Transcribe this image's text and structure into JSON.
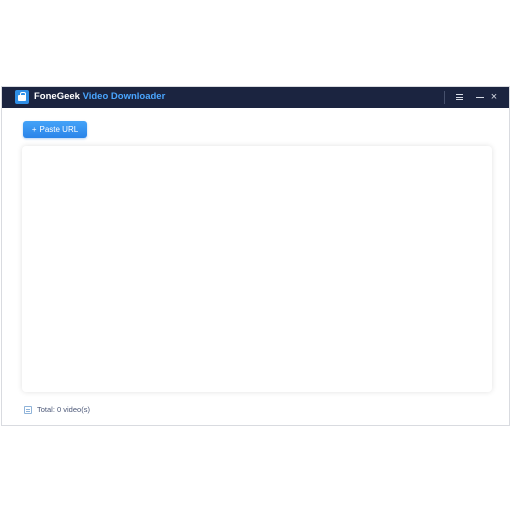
{
  "app": {
    "brand": "FoneGeek",
    "product": "Video Downloader"
  },
  "toolbar": {
    "paste_url_label": "Paste URL",
    "paste_url_prefix": "+"
  },
  "window_controls": {
    "close_glyph": "×"
  },
  "status_bar": {
    "total_text": "Total: 0 video(s)"
  },
  "colors": {
    "titlebar": "#1b2440",
    "accent": "#2f8fe6",
    "product_title": "#4aa6ff"
  },
  "icons": {
    "logo": "app-logo-icon",
    "menu": "menu-icon",
    "minimize": "minimize-icon",
    "close": "close-icon",
    "status": "list-icon"
  }
}
